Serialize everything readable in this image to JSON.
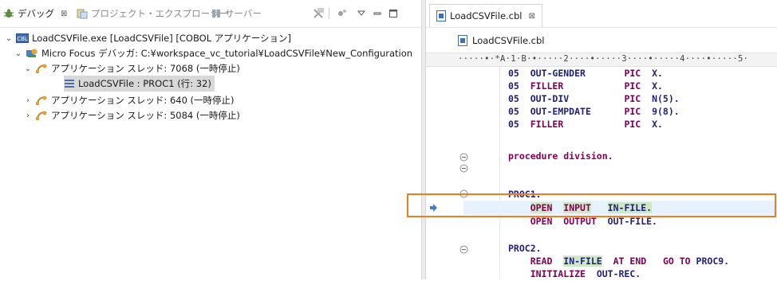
{
  "left_panel": {
    "tabs": [
      {
        "label": "デバッグ",
        "icon": "debug-bug-icon",
        "active": true,
        "close": "⊠"
      },
      {
        "label": "プロジェクト・エクスプローラー",
        "icon": "project-explorer-icon",
        "active": false
      },
      {
        "label": "サーバー",
        "icon": "servers-icon",
        "active": false
      }
    ],
    "toolbar_icons": [
      "remove-terminated-icon",
      "debug-options-icon",
      "view-menu-icon",
      "minimize-icon",
      "maximize-icon"
    ],
    "tree": [
      {
        "level": 0,
        "expanded": true,
        "icon": "cbl-exe-icon",
        "label": "LoadCSVFile.exe [LoadCSVFile] [COBOL アプリケーション]"
      },
      {
        "level": 1,
        "expanded": true,
        "icon": "debugger-icon",
        "label": "Micro Focus デバッガ: C:¥workspace_vc_tutorial¥LoadCSVFile¥New_Configuration"
      },
      {
        "level": 2,
        "expanded": true,
        "icon": "thread-icon",
        "label": "アプリケーション スレッド: 7068 (一時停止)"
      },
      {
        "level": 3,
        "expanded": null,
        "icon": "stack-frame-icon",
        "label": "LoadCSVFile : PROC1 (行: 32)",
        "selected": true
      },
      {
        "level": 2,
        "expanded": false,
        "icon": "thread-icon",
        "label": "アプリケーション スレッド: 640 (一時停止)"
      },
      {
        "level": 2,
        "expanded": false,
        "icon": "thread-icon",
        "label": "アプリケーション スレッド: 5084 (一時停止)"
      }
    ]
  },
  "editor": {
    "tab_label": "LoadCSVFile.cbl",
    "tab_close": "⊠",
    "breadcrumb": "LoadCSVFile.cbl",
    "ruler": "·····•·*A·1·B·•·····2····•·····3····•·····4····•·····5·",
    "lines": [
      {
        "text": "05  OUT-GENDER       PIC  X."
      },
      {
        "text": "05  FILLER           PIC  X."
      },
      {
        "text": "05  OUT-DIV          PIC  N(5)."
      },
      {
        "text": "05  OUT-EMPDATE      PIC  9(8)."
      },
      {
        "text": "05  FILLER           PIC  X."
      },
      {
        "text": "procedure division."
      },
      {
        "text": "PROC1."
      },
      {
        "text": "    OPEN  INPUT   IN-FILE."
      },
      {
        "text": "    OPEN  OUTPUT  OUT-FILE."
      },
      {
        "text": "PROC2."
      },
      {
        "text": "    READ  IN-FILE  AT END   GO TO PROC9."
      },
      {
        "text": "    INITIALIZE  OUT-REC."
      }
    ]
  },
  "colors": {
    "keyword": "#7f0055",
    "identifier": "#1f1f7a",
    "highlight_box": "#ef7d1f",
    "selection": "#d8d8d8",
    "current_line": "#e8f2fe"
  }
}
